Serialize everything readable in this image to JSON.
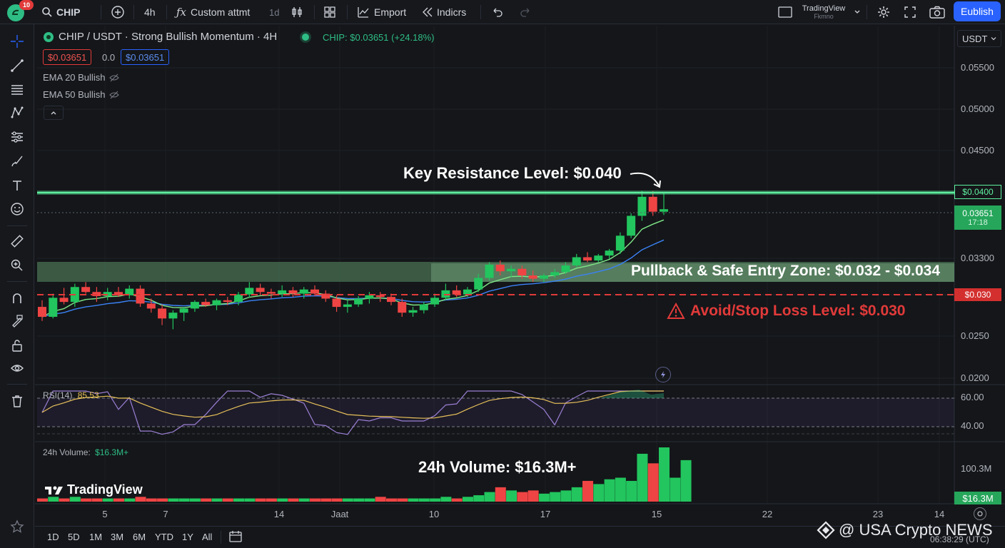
{
  "toolbar": {
    "notification_count": "10",
    "symbol": "CHIP",
    "interval": "4h",
    "custom_item": "Custom attmt",
    "interval_alt": "1d",
    "export_label": "Emport",
    "indicators_label": "Indicrs",
    "layout_name": "TradingView",
    "layout_sub": "Fkmno",
    "publish_label": "Eublish"
  },
  "legend": {
    "pair_title": "CHIP / USDT · Strong Bullish Momentum · 4H",
    "live_quote": "CHIP: $0.03651 (+24.18%)",
    "bid": "$0.03651",
    "spread": "0.0",
    "ask": "$0.03651",
    "ema20": "EMA 20 Bullish",
    "ema50": "EMA 50 Bullish"
  },
  "currency": "USDT",
  "annotations": {
    "resistance": "Key Resistance Level: $0.040",
    "entry_zone": "Pullback & Safe Entry Zone: $0.032 - $0.034",
    "stop_loss": "Avoid/Stop Loss Level: $0.030",
    "volume": "24h Volume: $16.3M+"
  },
  "rsi_panel": {
    "label": "RSI(14)",
    "value": "85.53",
    "upper": "60.00",
    "lower": "40.00"
  },
  "volume_panel": {
    "label": "24h Volume:",
    "value": "$16.3M+",
    "axis_label": "100.3M",
    "last_tag": "$16.3M"
  },
  "brand": "TradingView",
  "watermark": "@ USA Crypto NEWS",
  "clock": "06:38:29 (UTC)",
  "ranges": [
    "1D",
    "5D",
    "1M",
    "3M",
    "6M",
    "YTD",
    "1Y",
    "All"
  ],
  "colors": {
    "bull": "#26a69a",
    "bear": "#ef5350",
    "resistance": "#5ef0a0",
    "stop": "#e23a3a",
    "accent": "#2962ff"
  },
  "chart_data": {
    "type": "candlestick",
    "title": "CHIP / USDT · Strong Bullish Momentum · 4H",
    "y_axis_ticks": [
      "0.05500",
      "0.05000",
      "0.04500",
      "0.03300",
      "0.0250",
      "0.0200"
    ],
    "price_tags": {
      "resistance": "$0.0400",
      "last": "0.03651",
      "countdown": "17:18",
      "stop": "$0.030"
    },
    "x_ticks": [
      "5",
      "7",
      "14",
      "Jaat",
      "10",
      "17",
      "15",
      "22",
      "23",
      "14"
    ],
    "levels": {
      "resistance": 0.04,
      "entry_zone": [
        0.032,
        0.034
      ],
      "stop_loss": 0.03
    },
    "candles": [
      {
        "o": 0.0262,
        "h": 0.027,
        "l": 0.0245,
        "c": 0.025
      },
      {
        "o": 0.025,
        "h": 0.0278,
        "l": 0.0248,
        "c": 0.0273
      },
      {
        "o": 0.0273,
        "h": 0.0285,
        "l": 0.0265,
        "c": 0.0268
      },
      {
        "o": 0.0268,
        "h": 0.029,
        "l": 0.0262,
        "c": 0.0286
      },
      {
        "o": 0.0286,
        "h": 0.0292,
        "l": 0.0278,
        "c": 0.028
      },
      {
        "o": 0.028,
        "h": 0.0286,
        "l": 0.0268,
        "c": 0.0275
      },
      {
        "o": 0.0275,
        "h": 0.0285,
        "l": 0.027,
        "c": 0.028
      },
      {
        "o": 0.028,
        "h": 0.0286,
        "l": 0.0274,
        "c": 0.0276
      },
      {
        "o": 0.0276,
        "h": 0.0288,
        "l": 0.0272,
        "c": 0.0284
      },
      {
        "o": 0.0284,
        "h": 0.0288,
        "l": 0.0262,
        "c": 0.0266
      },
      {
        "o": 0.0266,
        "h": 0.0272,
        "l": 0.0255,
        "c": 0.026
      },
      {
        "o": 0.026,
        "h": 0.0265,
        "l": 0.024,
        "c": 0.0248
      },
      {
        "o": 0.0248,
        "h": 0.0258,
        "l": 0.0235,
        "c": 0.0255
      },
      {
        "o": 0.0255,
        "h": 0.0262,
        "l": 0.0245,
        "c": 0.026
      },
      {
        "o": 0.026,
        "h": 0.027,
        "l": 0.0256,
        "c": 0.0268
      },
      {
        "o": 0.0268,
        "h": 0.0272,
        "l": 0.0262,
        "c": 0.0264
      },
      {
        "o": 0.0264,
        "h": 0.0272,
        "l": 0.0258,
        "c": 0.027
      },
      {
        "o": 0.027,
        "h": 0.0274,
        "l": 0.0264,
        "c": 0.0268
      },
      {
        "o": 0.0268,
        "h": 0.028,
        "l": 0.0264,
        "c": 0.0277
      },
      {
        "o": 0.0277,
        "h": 0.0292,
        "l": 0.0273,
        "c": 0.0285
      },
      {
        "o": 0.0285,
        "h": 0.029,
        "l": 0.0276,
        "c": 0.028
      },
      {
        "o": 0.028,
        "h": 0.0284,
        "l": 0.0272,
        "c": 0.0278
      },
      {
        "o": 0.0278,
        "h": 0.0288,
        "l": 0.0274,
        "c": 0.0282
      },
      {
        "o": 0.0282,
        "h": 0.0286,
        "l": 0.0274,
        "c": 0.0278
      },
      {
        "o": 0.0278,
        "h": 0.0286,
        "l": 0.0272,
        "c": 0.0283
      },
      {
        "o": 0.0283,
        "h": 0.0288,
        "l": 0.0275,
        "c": 0.0278
      },
      {
        "o": 0.0278,
        "h": 0.0282,
        "l": 0.0268,
        "c": 0.0272
      },
      {
        "o": 0.0272,
        "h": 0.0276,
        "l": 0.0256,
        "c": 0.0262
      },
      {
        "o": 0.0262,
        "h": 0.027,
        "l": 0.0255,
        "c": 0.0265
      },
      {
        "o": 0.0265,
        "h": 0.0275,
        "l": 0.0262,
        "c": 0.0272
      },
      {
        "o": 0.0272,
        "h": 0.028,
        "l": 0.0266,
        "c": 0.0276
      },
      {
        "o": 0.0276,
        "h": 0.028,
        "l": 0.0268,
        "c": 0.0274
      },
      {
        "o": 0.0274,
        "h": 0.0278,
        "l": 0.0264,
        "c": 0.0268
      },
      {
        "o": 0.0268,
        "h": 0.0272,
        "l": 0.025,
        "c": 0.0255
      },
      {
        "o": 0.0255,
        "h": 0.0262,
        "l": 0.025,
        "c": 0.0258
      },
      {
        "o": 0.0258,
        "h": 0.0268,
        "l": 0.0254,
        "c": 0.0265
      },
      {
        "o": 0.0265,
        "h": 0.0278,
        "l": 0.0262,
        "c": 0.0273
      },
      {
        "o": 0.0273,
        "h": 0.029,
        "l": 0.027,
        "c": 0.0282
      },
      {
        "o": 0.0282,
        "h": 0.0288,
        "l": 0.0274,
        "c": 0.0277
      },
      {
        "o": 0.0277,
        "h": 0.0286,
        "l": 0.0274,
        "c": 0.0283
      },
      {
        "o": 0.0283,
        "h": 0.0302,
        "l": 0.028,
        "c": 0.0297
      },
      {
        "o": 0.0297,
        "h": 0.0316,
        "l": 0.0294,
        "c": 0.0313
      },
      {
        "o": 0.0313,
        "h": 0.0318,
        "l": 0.03,
        "c": 0.0305
      },
      {
        "o": 0.0305,
        "h": 0.0312,
        "l": 0.0298,
        "c": 0.0308
      },
      {
        "o": 0.0308,
        "h": 0.0312,
        "l": 0.0296,
        "c": 0.03
      },
      {
        "o": 0.03,
        "h": 0.0306,
        "l": 0.0292,
        "c": 0.0296
      },
      {
        "o": 0.0296,
        "h": 0.0302,
        "l": 0.0292,
        "c": 0.03
      },
      {
        "o": 0.03,
        "h": 0.0308,
        "l": 0.0297,
        "c": 0.0304
      },
      {
        "o": 0.0304,
        "h": 0.0316,
        "l": 0.0302,
        "c": 0.0312
      },
      {
        "o": 0.0312,
        "h": 0.0326,
        "l": 0.031,
        "c": 0.0322
      },
      {
        "o": 0.0322,
        "h": 0.0328,
        "l": 0.0316,
        "c": 0.0318
      },
      {
        "o": 0.0318,
        "h": 0.0326,
        "l": 0.0316,
        "c": 0.0324
      },
      {
        "o": 0.0324,
        "h": 0.0332,
        "l": 0.032,
        "c": 0.033
      },
      {
        "o": 0.033,
        "h": 0.0352,
        "l": 0.0326,
        "c": 0.0348
      },
      {
        "o": 0.0348,
        "h": 0.0375,
        "l": 0.0345,
        "c": 0.0372
      },
      {
        "o": 0.0372,
        "h": 0.0402,
        "l": 0.0366,
        "c": 0.0395
      },
      {
        "o": 0.0395,
        "h": 0.0402,
        "l": 0.0372,
        "c": 0.0377
      },
      {
        "o": 0.0377,
        "h": 0.04,
        "l": 0.0373,
        "c": 0.038
      }
    ],
    "volume": [
      2,
      3,
      2,
      3,
      2,
      2,
      2,
      2,
      2,
      3,
      2,
      2,
      2,
      2,
      2,
      2,
      2,
      2,
      2,
      2,
      2,
      2,
      2,
      2,
      2,
      2,
      2,
      2,
      2,
      2,
      2,
      3,
      2,
      2,
      2,
      2,
      2,
      3,
      2,
      3,
      4,
      6,
      9,
      7,
      6,
      7,
      5,
      6,
      7,
      9,
      13,
      11,
      14,
      15,
      13,
      30,
      24,
      34,
      15,
      26
    ]
  }
}
